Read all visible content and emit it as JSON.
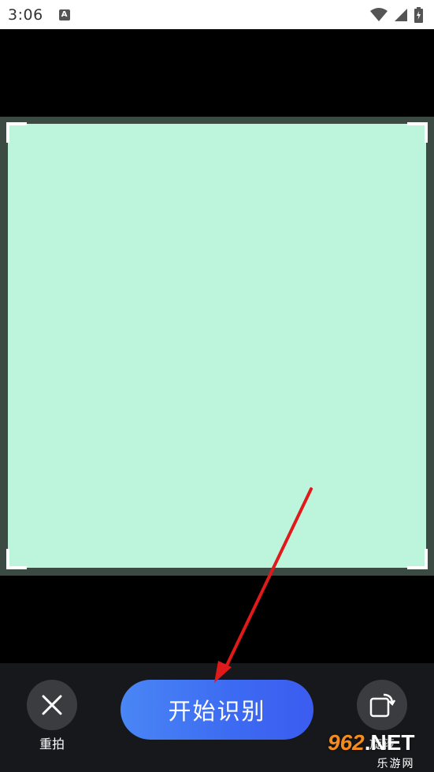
{
  "status_bar": {
    "time": "3:06",
    "notification_letter": "A"
  },
  "bottom_bar": {
    "retake_label": "重拍",
    "start_label": "开始识别",
    "rotate_label": "旋转"
  },
  "watermark": {
    "number": "962",
    "suffix": ".NET",
    "site": "乐游网"
  },
  "colors": {
    "photo_fill": "#bcf5dc",
    "frame": "#3b4b44",
    "button_gradient_start": "#4a86f5",
    "button_gradient_end": "#3b5cf0",
    "arrow": "#e01a1a"
  }
}
